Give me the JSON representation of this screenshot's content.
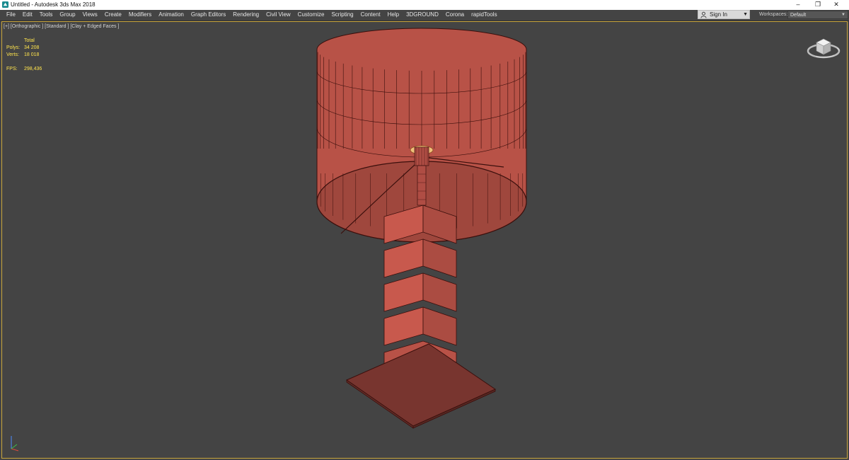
{
  "titlebar": {
    "title": "Untitled - Autodesk 3ds Max 2018",
    "icon": "3ds-max-app-icon",
    "minimize": "–",
    "maximize": "❐",
    "close": "✕"
  },
  "menubar": {
    "items": [
      "File",
      "Edit",
      "Tools",
      "Group",
      "Views",
      "Create",
      "Modifiers",
      "Animation",
      "Graph Editors",
      "Rendering",
      "Civil View",
      "Customize",
      "Scripting",
      "Content",
      "Help",
      "3DGROUND",
      "Corona",
      "rapidTools"
    ],
    "signin": {
      "icon": "user-icon",
      "label": "Sign In"
    },
    "workspaces": {
      "label": "Workspaces:",
      "value": "Default"
    }
  },
  "viewport": {
    "label": "[+] [Orthographic ] [Standard ] [Clay + Edged Faces ]",
    "stats": {
      "header": "Total",
      "polys_label": "Polys:",
      "polys_value": "34 208",
      "verts_label": "Verts:",
      "verts_value": "18 018",
      "fps_label": "FPS:",
      "fps_value": "298,436"
    },
    "object_color": "#c2564b",
    "wire_color": "#3a0f0c",
    "viewcube_icon": "viewcube-icon",
    "axis_icon": "axis-tripod-icon"
  }
}
